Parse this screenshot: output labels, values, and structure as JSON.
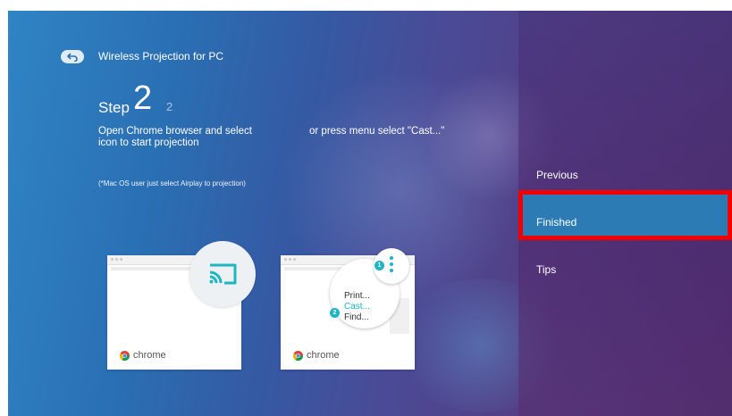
{
  "header": {
    "title": "Wireless Projection for PC"
  },
  "step": {
    "label": "Step",
    "current": "2",
    "total": "2"
  },
  "instructions": {
    "line1": "Open Chrome browser and select",
    "line2": "icon to start projection",
    "right": "or press menu select \"Cast...\"",
    "note": "(*Mac OS user just select Airplay to projection)"
  },
  "illustration": {
    "card_label": "chrome",
    "menu_items": [
      "Print...",
      "Cast...",
      "Find..."
    ],
    "badges": [
      "1",
      "2"
    ]
  },
  "menu": {
    "items": [
      "Previous",
      "Finished",
      "Tips"
    ],
    "selected": "Finished"
  },
  "colors": {
    "accent": "#1fb5c4",
    "highlight_border": "#f20000",
    "selected_row": "#2c7bb4"
  },
  "icons": [
    "back-icon",
    "cast-icon",
    "chrome-icon",
    "more-vertical-icon"
  ]
}
